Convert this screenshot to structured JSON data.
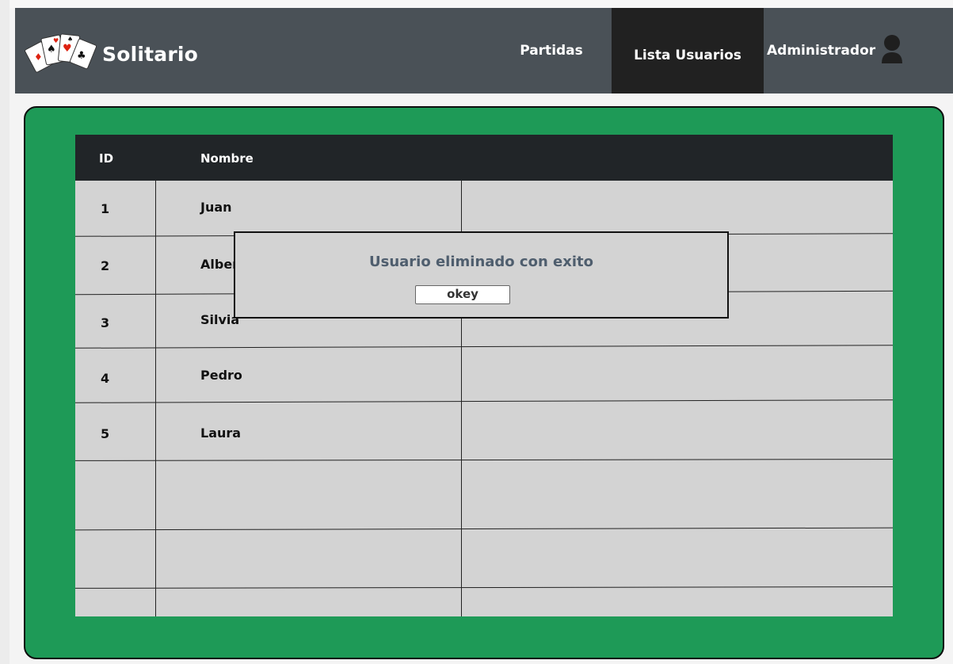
{
  "header": {
    "brand": "Solitario",
    "nav": {
      "partidas": "Partidas",
      "lista_usuarios": "Lista Usuarios",
      "administrador": "Administrador"
    }
  },
  "table": {
    "columns": [
      "ID",
      "Nombre"
    ],
    "rows": [
      {
        "id": "1",
        "nombre": "Juan"
      },
      {
        "id": "2",
        "nombre": "Alberto"
      },
      {
        "id": "3",
        "nombre": "Silvia"
      },
      {
        "id": "4",
        "nombre": "Pedro"
      },
      {
        "id": "5",
        "nombre": "Laura"
      }
    ]
  },
  "modal": {
    "message": "Usuario eliminado con exito",
    "button": "okey"
  },
  "colors": {
    "header_bg": "#4a5157",
    "active_tab": "#212121",
    "board_green": "#1e9a57",
    "table_head": "#212528",
    "table_body": "#d3d3d3"
  },
  "icons": [
    "cards-logo-icon",
    "user-icon"
  ]
}
